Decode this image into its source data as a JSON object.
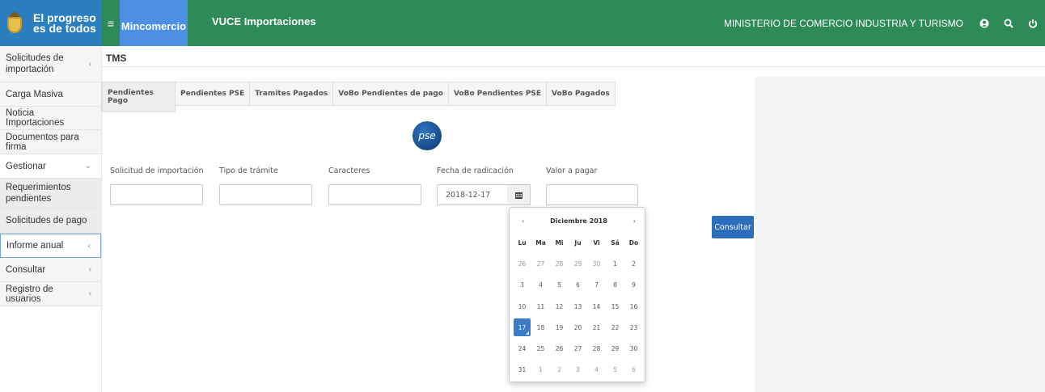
{
  "header": {
    "brand_line1": "El progreso",
    "brand_line2": "es de todos",
    "menu_icon": "hamburger-icon",
    "entity": "Mincomercio",
    "app_title": "VUCE Importaciones",
    "ministry": "MINISTERIO DE COMERCIO INDUSTRIA Y TURISMO",
    "icons": [
      "user-circle-icon",
      "search-icon",
      "power-icon"
    ],
    "brand_color": "#2e8b57",
    "accent_color": "#4d8fe0"
  },
  "sidebar": {
    "items": [
      {
        "label": "Solicitudes de importación",
        "chevron": "‹"
      },
      {
        "label": "Carga Masiva"
      },
      {
        "label": "Noticia Importaciones"
      },
      {
        "label": "Documentos para firma"
      },
      {
        "label": "Gestionar",
        "chevron": "⌄"
      },
      {
        "label": "Requerimientos pendientes"
      },
      {
        "label": "Solicitudes de pago"
      },
      {
        "label": "Informe anual",
        "chevron": "‹"
      },
      {
        "label": "Consultar",
        "chevron": "‹"
      },
      {
        "label": "Registro de usuarios",
        "chevron": "‹"
      }
    ]
  },
  "main": {
    "section_title": "TMS",
    "tabs": [
      "Pendientes Pago",
      "Pendientes PSE",
      "Tramites Pagados",
      "VoBo Pendientes de pago",
      "VoBo Pendientes PSE",
      "VoBo Pagados"
    ],
    "logo_text": "pse",
    "fields": {
      "solicitud_label": "Solicitud de importación",
      "solicitud_value": "",
      "tipo_label": "Tipo de trámite",
      "tipo_value": "",
      "caracteres_label": "Caracteres",
      "caracteres_value": "",
      "fecha_label": "Fecha de radicación",
      "fecha_value": "2018-12-17",
      "valor_label": "Valor a pagar",
      "valor_value": ""
    },
    "consultar_label": "Consultar"
  },
  "datepicker": {
    "title": "Diciembre 2018",
    "prev": "‹",
    "next": "›",
    "weekdays": [
      "Lu",
      "Ma",
      "Mi",
      "Ju",
      "Vi",
      "Sá",
      "Do"
    ],
    "weeks": [
      [
        "26",
        "27",
        "28",
        "29",
        "30",
        "1",
        "2"
      ],
      [
        "3",
        "4",
        "5",
        "6",
        "7",
        "8",
        "9"
      ],
      [
        "10",
        "11",
        "12",
        "13",
        "14",
        "15",
        "16"
      ],
      [
        "17",
        "18",
        "19",
        "20",
        "21",
        "22",
        "23"
      ],
      [
        "24",
        "25",
        "26",
        "27",
        "28",
        "29",
        "30"
      ],
      [
        "31",
        "1",
        "2",
        "3",
        "4",
        "5",
        "6"
      ]
    ],
    "selected": "17"
  }
}
